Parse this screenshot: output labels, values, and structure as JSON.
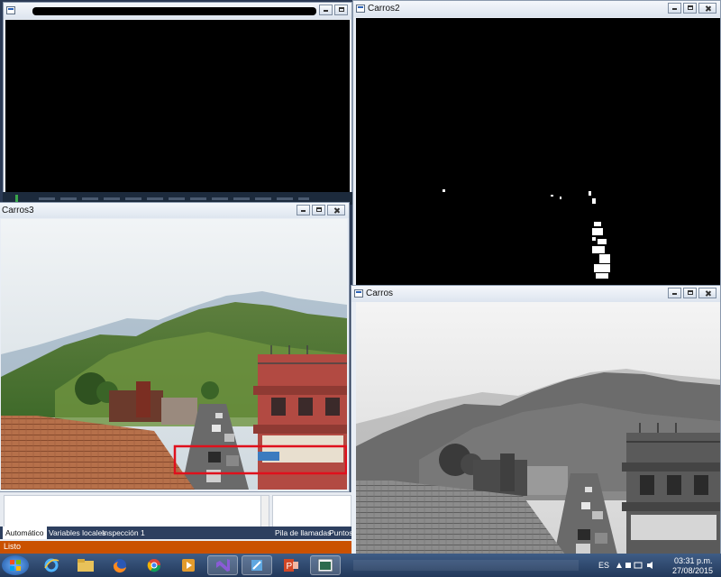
{
  "windows": {
    "top_left": {
      "title_redacted": true
    },
    "carros3": {
      "title": "Carros3"
    },
    "carros2": {
      "title": "Carros2"
    },
    "carros": {
      "title": "Carros"
    }
  },
  "ide": {
    "tabs": [
      "Automático",
      "Variables locales",
      "Inspección 1"
    ],
    "right_tabs": [
      "Pila de llamadas",
      "Puntos"
    ],
    "status": "Listo"
  },
  "taskbar": {
    "apps": [
      {
        "name": "windows-start-icon"
      },
      {
        "name": "internet-explorer-icon"
      },
      {
        "name": "file-explorer-icon"
      },
      {
        "name": "firefox-icon"
      },
      {
        "name": "chrome-icon"
      },
      {
        "name": "media-player-icon"
      },
      {
        "name": "visual-studio-icon"
      },
      {
        "name": "app-icon"
      },
      {
        "name": "powerpoint-icon"
      },
      {
        "name": "window-app-icon"
      }
    ],
    "language": "ES",
    "time": "03:31 p.m.",
    "date": "27/08/2015"
  },
  "colors": {
    "ide_status_bar": "#ca5100",
    "ide_tab_strip": "#2d3f5f",
    "detection_box": "#e0101c"
  }
}
